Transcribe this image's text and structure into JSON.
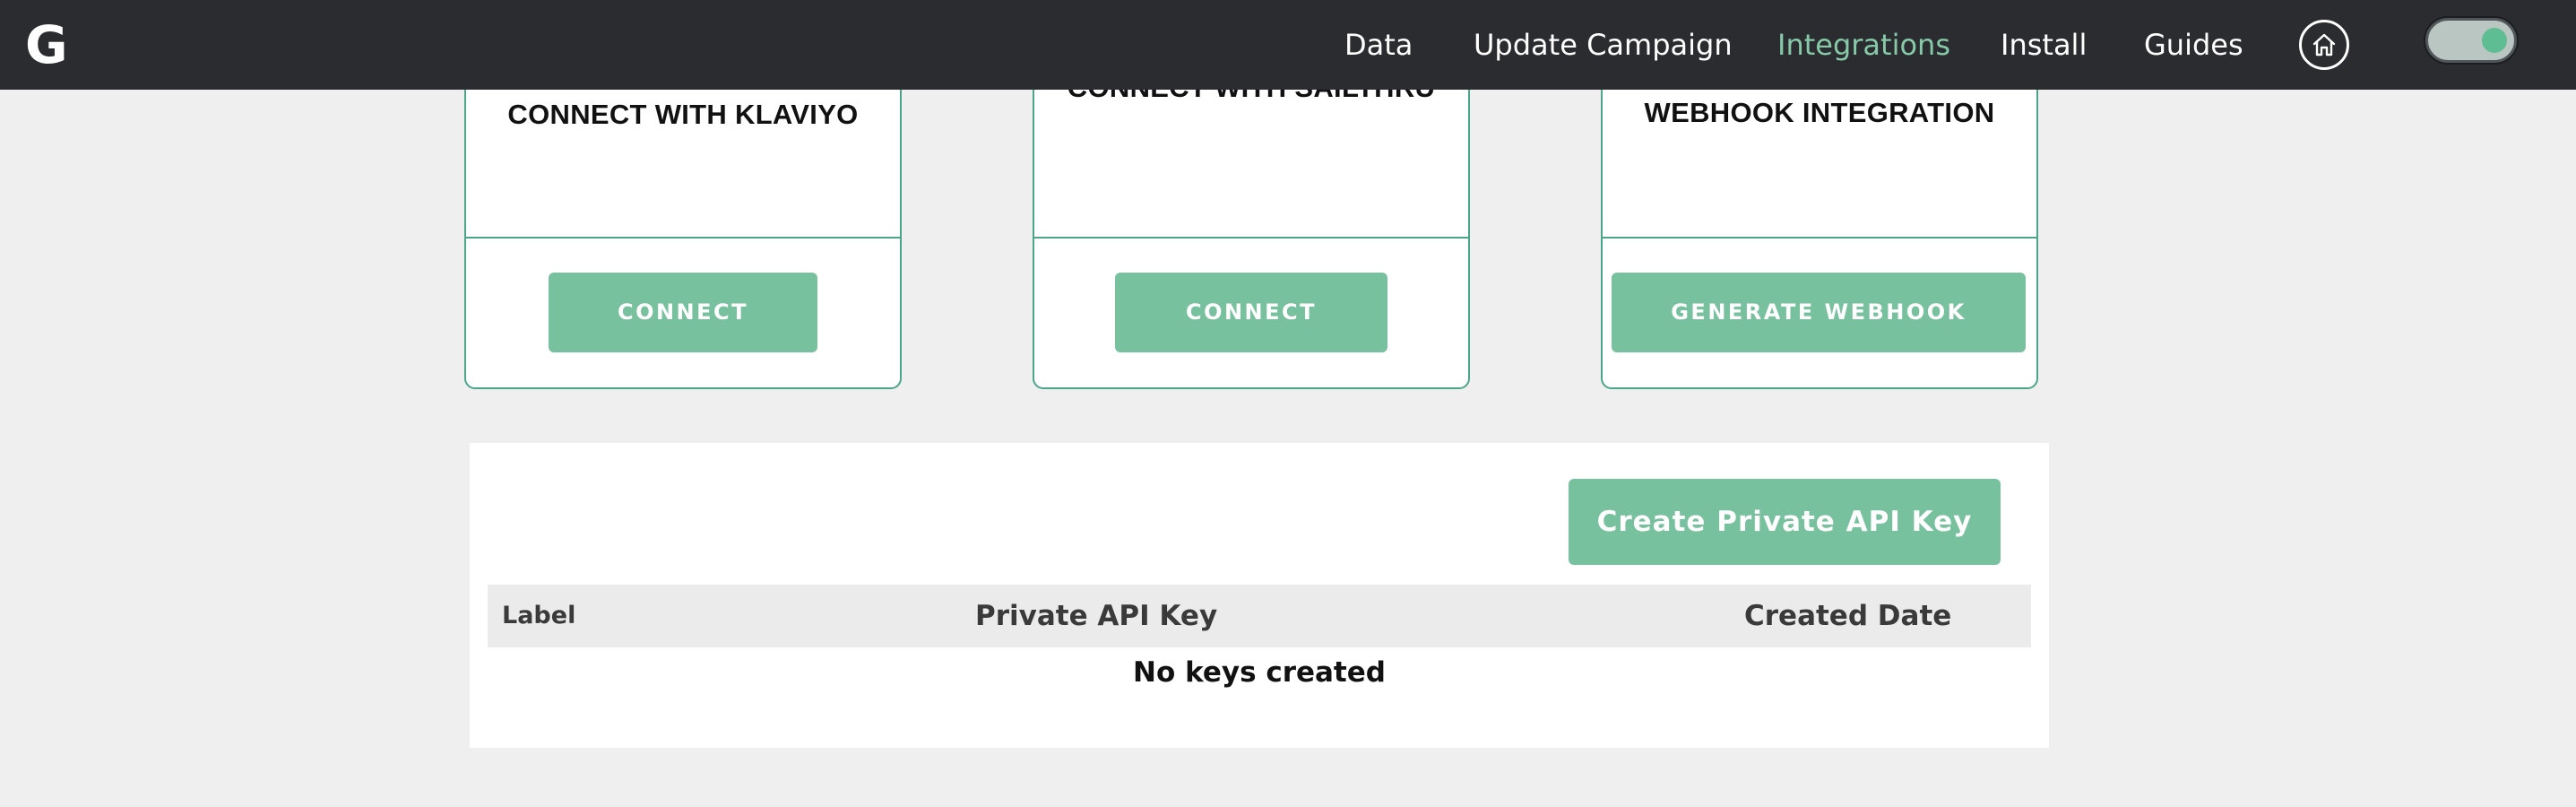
{
  "navbar": {
    "logo": "G",
    "items": [
      {
        "label": "Data",
        "active": false
      },
      {
        "label": "Update Campaign",
        "active": false
      },
      {
        "label": "Integrations",
        "active": true
      },
      {
        "label": "Install",
        "active": false
      },
      {
        "label": "Guides",
        "active": false
      }
    ],
    "home_icon": "home-icon",
    "toggle_state": "on"
  },
  "integrations": [
    {
      "title": "CONNECT WITH KLAVIYO",
      "button": "CONNECT"
    },
    {
      "title": "CONNECT WITH SAILTHRU",
      "button": "CONNECT"
    },
    {
      "title": "WEBHOOK INTEGRATION",
      "button": "GENERATE WEBHOOK"
    }
  ],
  "api_keys": {
    "create_button": "Create Private API Key",
    "columns": [
      "Label",
      "Private API Key",
      "Created Date"
    ],
    "rows": [],
    "empty_message": "No keys created"
  },
  "colors": {
    "navbar_bg": "#2b2c2f",
    "accent": "#78c19f",
    "active_nav": "#86c9a8",
    "card_border": "#4aa589",
    "page_bg": "#efefef"
  }
}
